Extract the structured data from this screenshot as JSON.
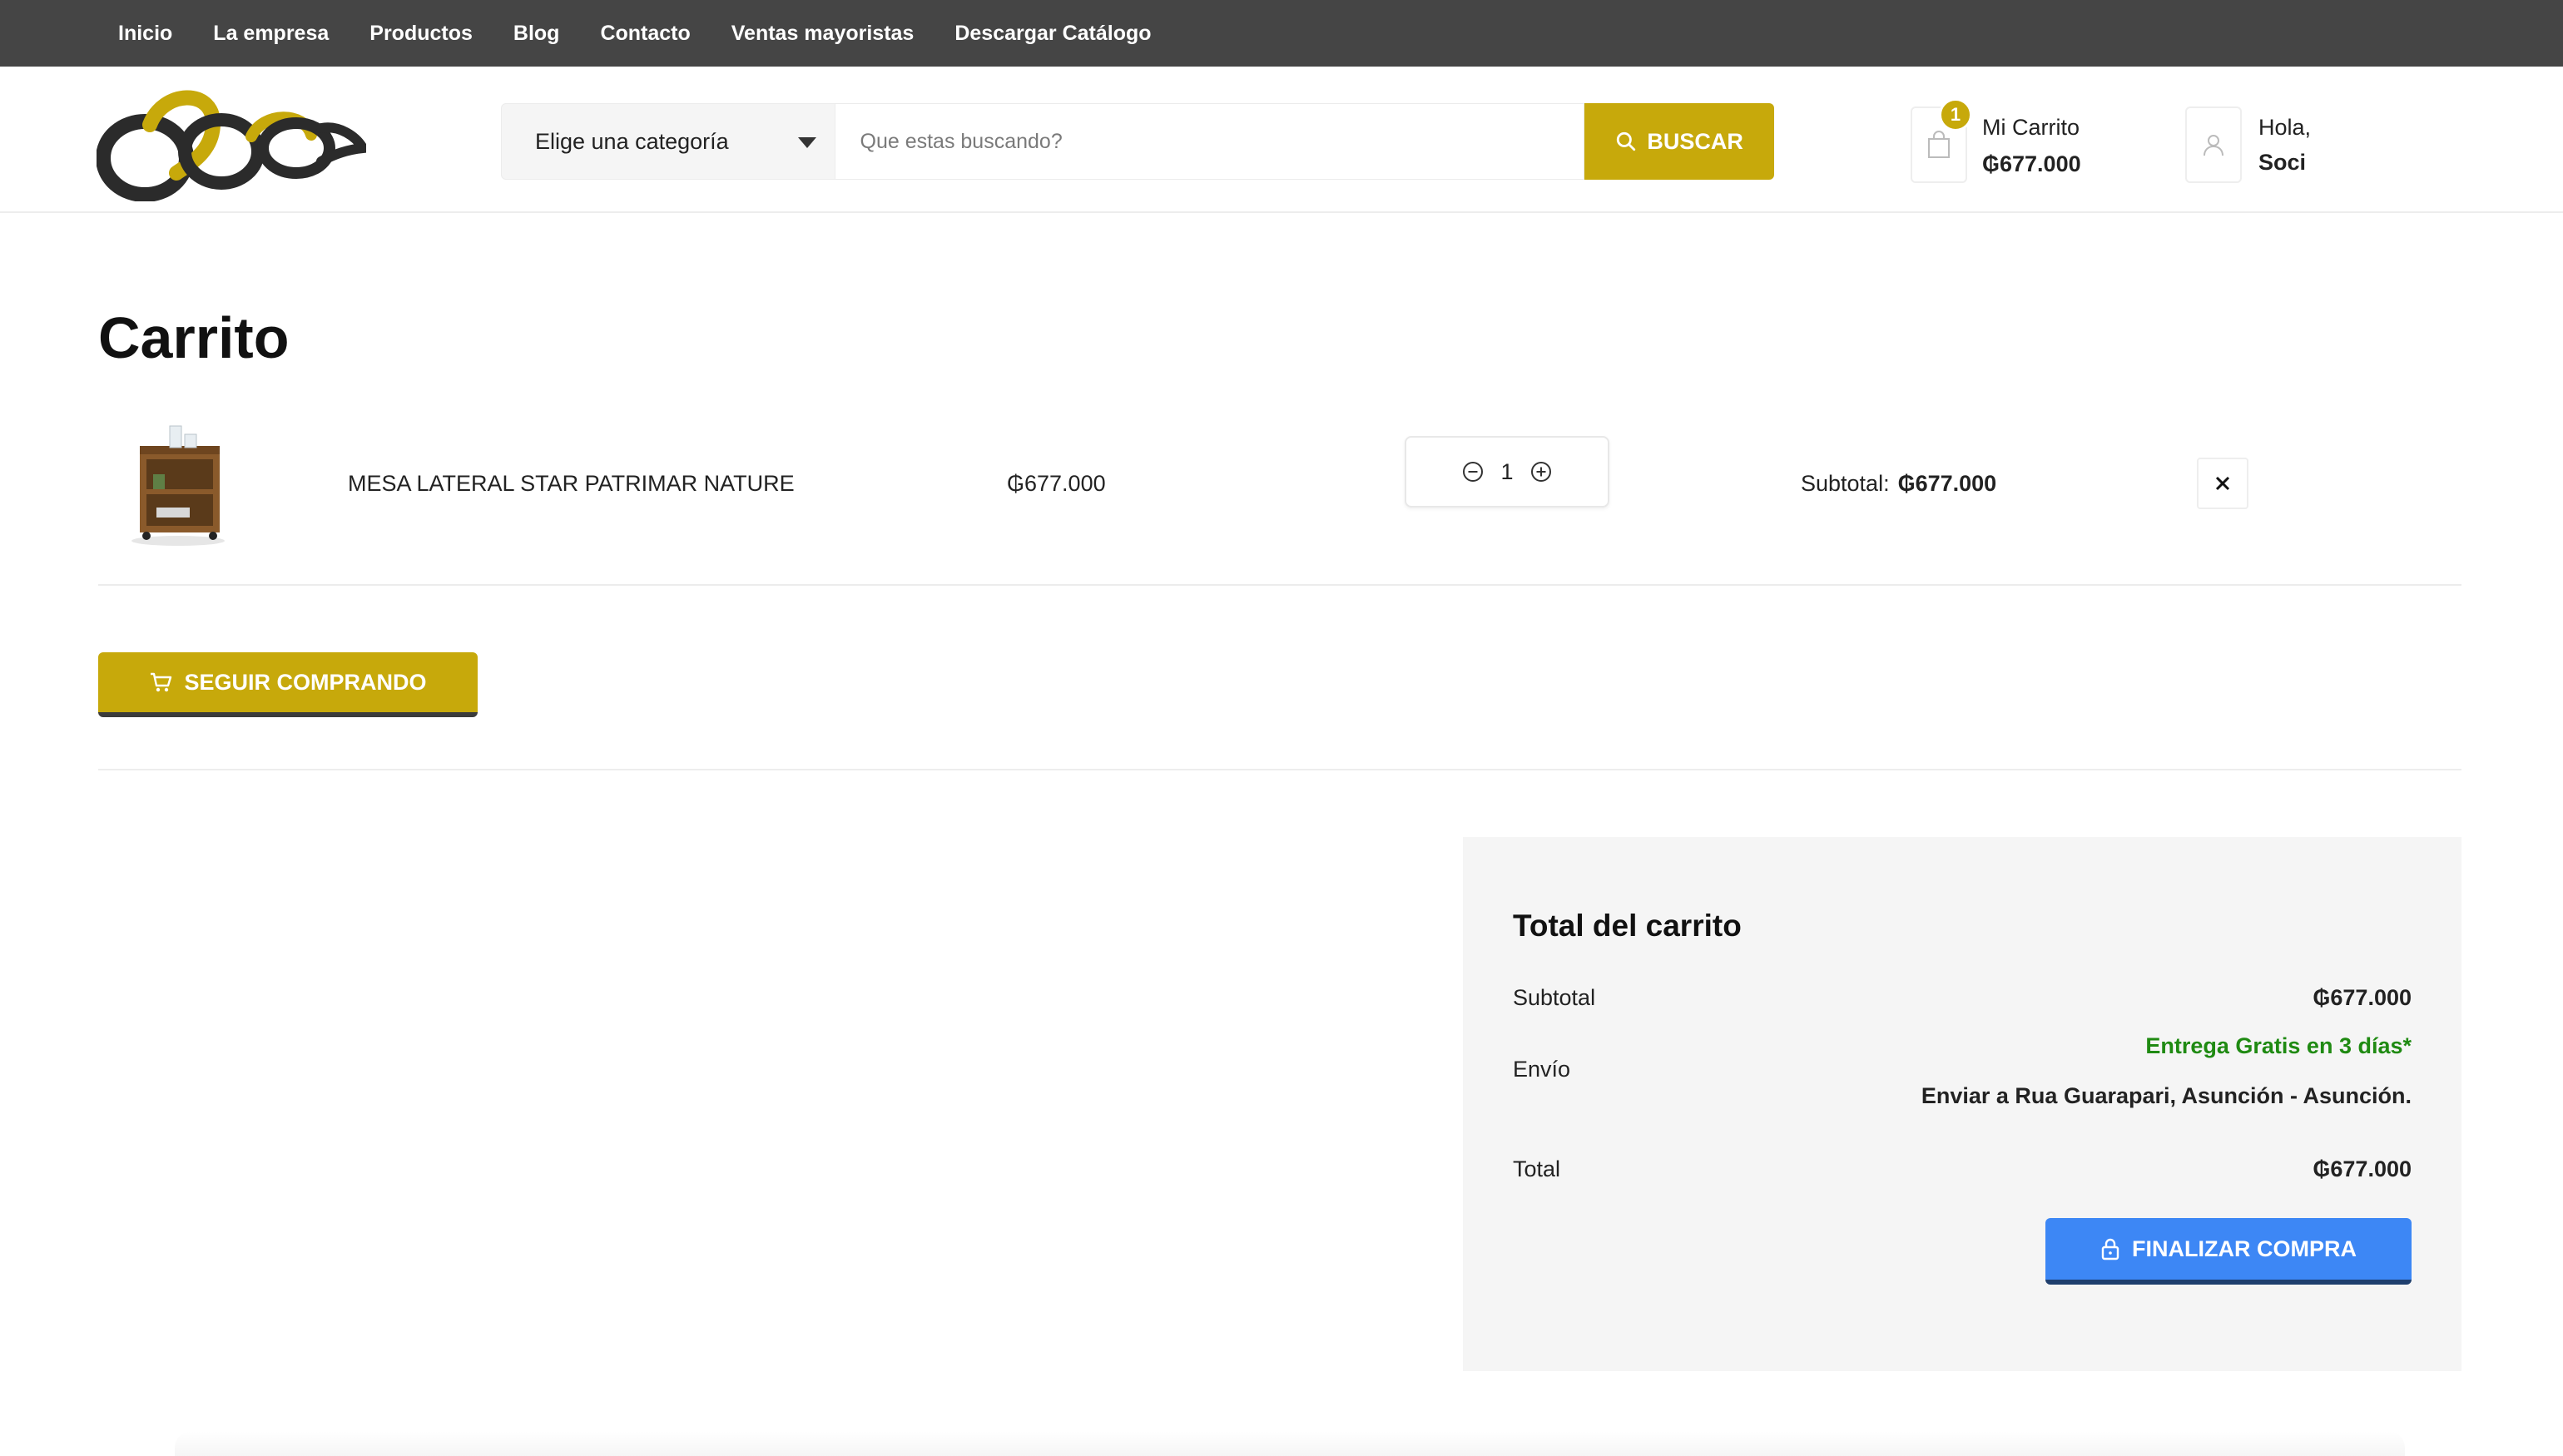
{
  "nav": {
    "items": [
      "Inicio",
      "La empresa",
      "Productos",
      "Blog",
      "Contacto",
      "Ventas mayoristas",
      "Descargar Catálogo"
    ]
  },
  "header": {
    "category_select": "Elige una categoría",
    "search_placeholder": "Que estas buscando?",
    "search_button": "BUSCAR",
    "cart": {
      "badge": "1",
      "label": "Mi Carrito",
      "total": "₲677.000"
    },
    "user": {
      "greeting": "Hola,",
      "name": "Soci"
    }
  },
  "page": {
    "title": "Carrito",
    "items": [
      {
        "name": "MESA LATERAL STAR PATRIMAR NATURE",
        "price": "₲677.000",
        "quantity": "1",
        "subtotal_label": "Subtotal:",
        "subtotal": "₲677.000"
      }
    ],
    "continue_button": "SEGUIR COMPRANDO"
  },
  "totals": {
    "title": "Total del carrito",
    "subtotal_label": "Subtotal",
    "subtotal_value": "₲677.000",
    "shipping_label": "Envío",
    "shipping_free": "Entrega Gratis en 3 días*",
    "shipping_address": "Enviar a Rua Guarapari, Asunción - Asunción.",
    "total_label": "Total",
    "total_value": "₲677.000",
    "checkout_button": "FINALIZAR COMPRA"
  },
  "colors": {
    "accent": "#c7a90b",
    "topbar": "#454545",
    "checkout": "#3d87f5",
    "free_shipping": "#1f8a12"
  }
}
